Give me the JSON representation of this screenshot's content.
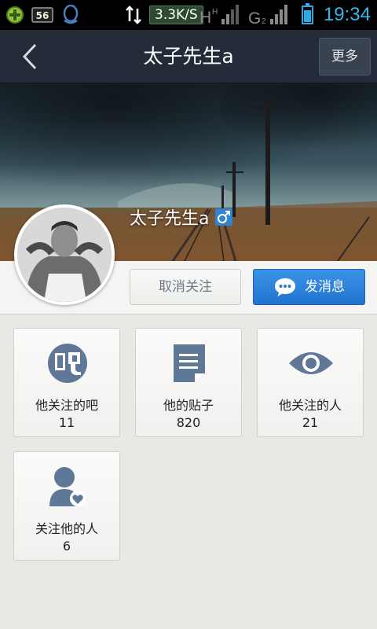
{
  "status_bar": {
    "speed": "3.3K/S",
    "network_badge": "56",
    "time": "19:34",
    "battery_level": 0.75,
    "icons": [
      "game-center-icon",
      "app-56-icon",
      "qq-icon",
      "data-transfer-icon",
      "signal-h-icon",
      "signal-g-icon",
      "battery-icon"
    ]
  },
  "nav": {
    "title": "太子先生a",
    "more_label": "更多",
    "back_icon": "back-arrow-icon"
  },
  "profile": {
    "name": "太子先生a",
    "gender_icon": "male-icon",
    "gender_color": "#2f84d3",
    "unfollow_label": "取消关注",
    "message_label": "发消息"
  },
  "tiles": [
    {
      "label": "他关注的吧",
      "count": "11",
      "icon": "bar-icon"
    },
    {
      "label": "他的贴子",
      "count": "820",
      "icon": "document-icon"
    },
    {
      "label": "他关注的人",
      "count": "21",
      "icon": "eye-icon"
    },
    {
      "label": "关注他的人",
      "count": "6",
      "icon": "follower-icon"
    }
  ],
  "colors": {
    "accent": "#2173cf",
    "icon_slate": "#5f7898",
    "nav_bg": "#232c38"
  }
}
